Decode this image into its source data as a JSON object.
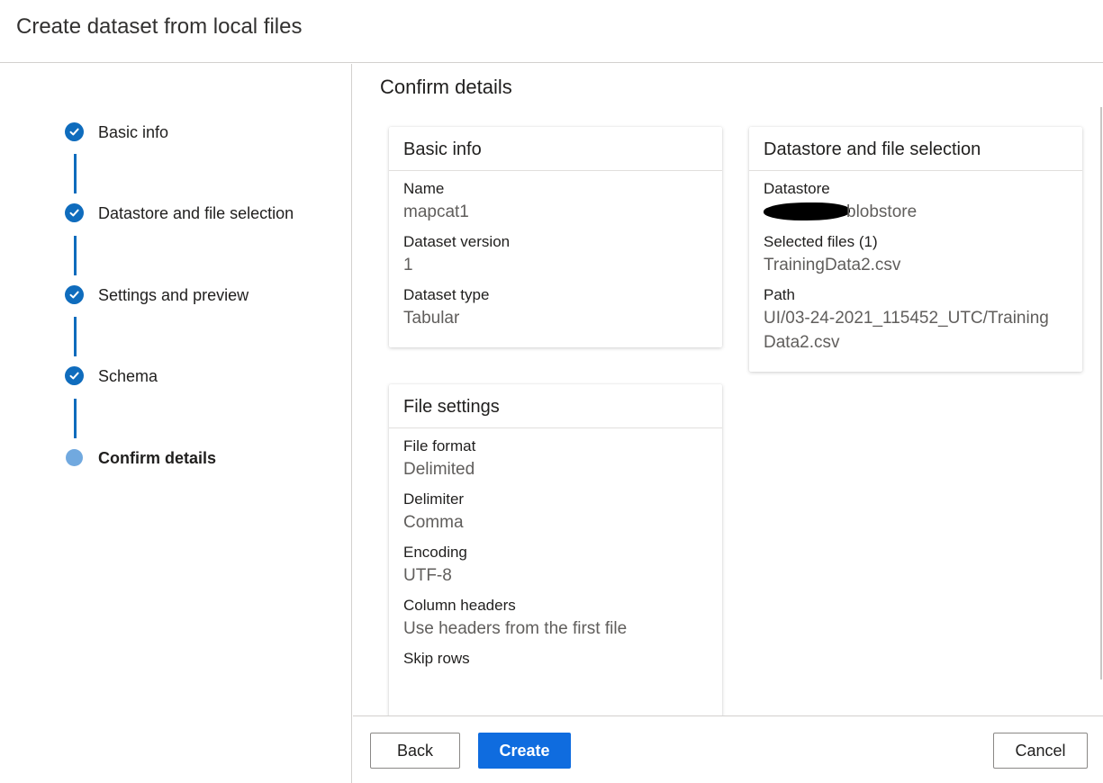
{
  "header": {
    "title": "Create dataset from local files"
  },
  "steps": [
    {
      "label": "Basic info",
      "status": "complete",
      "icon": "checkmark-icon"
    },
    {
      "label": "Datastore and file selection",
      "status": "complete",
      "icon": "checkmark-icon"
    },
    {
      "label": "Settings and preview",
      "status": "complete",
      "icon": "checkmark-icon"
    },
    {
      "label": "Schema",
      "status": "complete",
      "icon": "checkmark-icon"
    },
    {
      "label": "Confirm details",
      "status": "current",
      "icon": "current-step-dot-icon"
    }
  ],
  "main": {
    "title": "Confirm details",
    "basic_info": {
      "title": "Basic info",
      "name_label": "Name",
      "name_value": "mapcat1",
      "version_label": "Dataset version",
      "version_value": "1",
      "type_label": "Dataset type",
      "type_value": "Tabular"
    },
    "datastore": {
      "title": "Datastore and file selection",
      "datastore_label": "Datastore",
      "datastore_value": "blobstore",
      "files_label": "Selected files (1)",
      "files_value": "TrainingData2.csv",
      "path_label": "Path",
      "path_value": "UI/03-24-2021_115452_UTC/TrainingData2.csv"
    },
    "file_settings": {
      "title": "File settings",
      "format_label": "File format",
      "format_value": "Delimited",
      "delimiter_label": "Delimiter",
      "delimiter_value": "Comma",
      "encoding_label": "Encoding",
      "encoding_value": "UTF-8",
      "headers_label": "Column headers",
      "headers_value": "Use headers from the first file",
      "skip_label": "Skip rows"
    }
  },
  "footer": {
    "back_label": "Back",
    "create_label": "Create",
    "cancel_label": "Cancel"
  },
  "colors": {
    "accent": "#0f6cbd",
    "primary_button": "#0f6cdf",
    "current_step": "#71a9df"
  }
}
